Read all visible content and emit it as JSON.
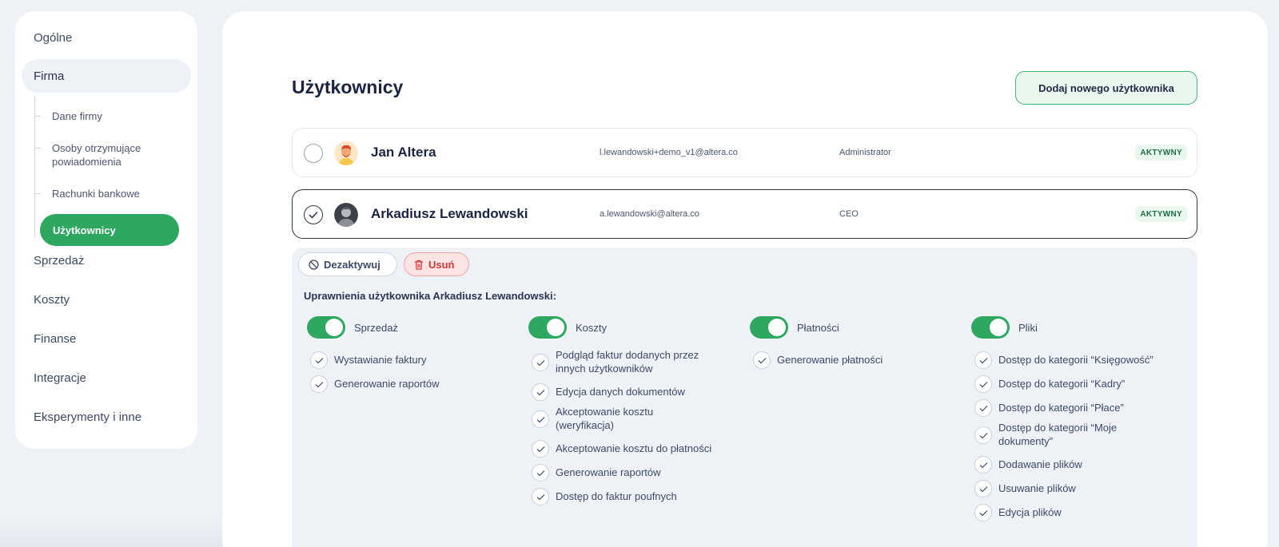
{
  "sidebar": {
    "items": [
      {
        "label": "Ogólne"
      },
      {
        "label": "Firma"
      },
      {
        "label": "Sprzedaż"
      },
      {
        "label": "Koszty"
      },
      {
        "label": "Finanse"
      },
      {
        "label": "Integracje"
      },
      {
        "label": "Eksperymenty i inne"
      }
    ],
    "sub_items": [
      {
        "label": "Dane firmy"
      },
      {
        "label": "Osoby otrzymujące powiadomienia"
      },
      {
        "label": "Rachunki bankowe"
      },
      {
        "label": "Użytkownicy"
      }
    ]
  },
  "main": {
    "title": "Użytkownicy",
    "add_button": "Dodaj nowego użytkownika",
    "users": [
      {
        "name": "Jan Altera",
        "email": "l.lewandowski+demo_v1@altera.co",
        "role": "Administrator",
        "status": "AKTYWNY"
      },
      {
        "name": "Arkadiusz Lewandowski",
        "email": "a.lewandowski@altera.co",
        "role": "CEO",
        "status": "AKTYWNY"
      }
    ],
    "actions": {
      "deactivate": "Dezaktywuj",
      "delete": "Usuń"
    },
    "permissions_title": "Uprawnienia użytkownika Arkadiusz Lewandowski:",
    "permission_groups": [
      {
        "name": "Sprzedaż",
        "items": [
          "Wystawianie faktury",
          "Generowanie raportów"
        ]
      },
      {
        "name": "Koszty",
        "items": [
          "Podgląd faktur dodanych przez innych użytkowników",
          "Edycja danych dokumentów",
          "Akceptowanie kosztu (weryfikacja)",
          "Akceptowanie kosztu do płatności",
          "Generowanie raportów",
          "Dostęp do faktur poufnych"
        ]
      },
      {
        "name": "Płatności",
        "items": [
          "Generowanie płatności"
        ]
      },
      {
        "name": "Pliki",
        "items": [
          "Dostęp do kategorii “Księgowość”",
          "Dostęp do kategorii “Kadry”",
          "Dostęp do kategorii “Płace”",
          "Dostęp do kategorii “Moje dokumenty”",
          "Dodawanie plików",
          "Usuwanie plików",
          "Edycja plików"
        ]
      }
    ]
  },
  "colors": {
    "accent": "#2ea860",
    "danger": "#d03838",
    "background": "#eef2f7"
  }
}
